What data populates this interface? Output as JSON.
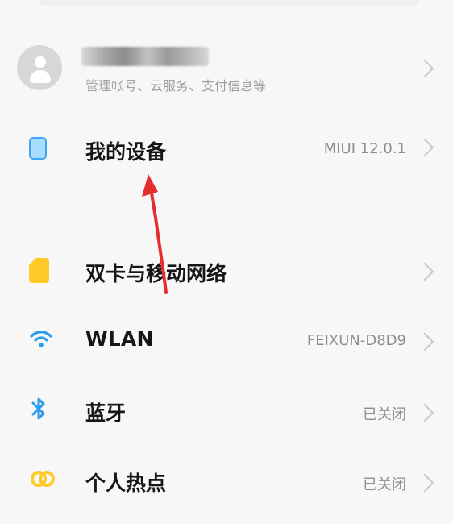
{
  "account": {
    "subtitle": "管理帐号、云服务、支付信息等",
    "avatar_icon": "user-avatar-icon"
  },
  "device": {
    "title": "我的设备",
    "value": "MIUI 12.0.1",
    "icon": "device-icon"
  },
  "sim": {
    "title": "双卡与移动网络",
    "icon": "sim-card-icon"
  },
  "wlan": {
    "title": "WLAN",
    "value": "FEIXUN-D8D9",
    "icon": "wifi-icon"
  },
  "bluetooth": {
    "title": "蓝牙",
    "value": "已关闭",
    "icon": "bluetooth-icon"
  },
  "hotspot": {
    "title": "个人热点",
    "value": "已关闭",
    "icon": "hotspot-icon"
  },
  "colors": {
    "background": "#f7f7f7",
    "blue": "#2d9cf0",
    "yellow": "#ffc928",
    "arrow": "#e52d2d"
  }
}
